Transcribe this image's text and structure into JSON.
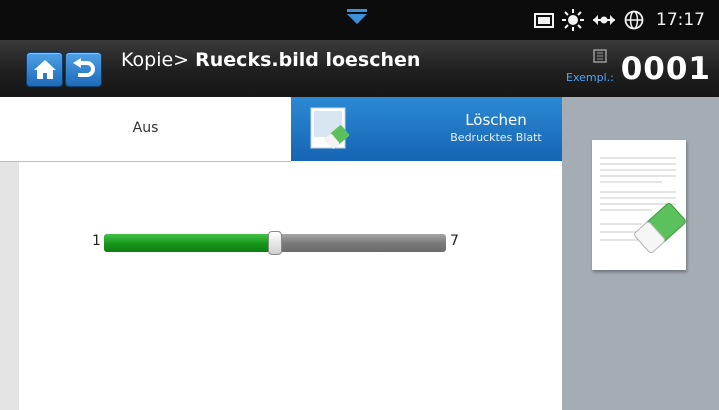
{
  "status_bar": {
    "pulldown_icon": "chevron-down-icon",
    "icons": [
      "storage-icon",
      "brightness-icon",
      "network-icon",
      "globe-icon"
    ],
    "time": "17:17"
  },
  "header": {
    "home_icon": "home-icon",
    "back_icon": "back-icon",
    "breadcrumb": "Kopie>",
    "title": "Ruecks.bild loeschen",
    "copies_label": "Exempl.:",
    "copies_value": "0001",
    "accent_color": "#2c89d4"
  },
  "tabs": [
    {
      "label": "Aus",
      "selected": false
    },
    {
      "label": "Löschen",
      "sublabel": "Bedrucktes Blatt",
      "selected": true,
      "icon": "eraser-page-icon"
    }
  ],
  "slider": {
    "min_label": "1",
    "max_label": "7",
    "min": 1,
    "max": 7,
    "value": 4,
    "fill_color": "#169619"
  },
  "preview": {
    "icon": "document-eraser-icon",
    "background": "#a5adb4"
  }
}
